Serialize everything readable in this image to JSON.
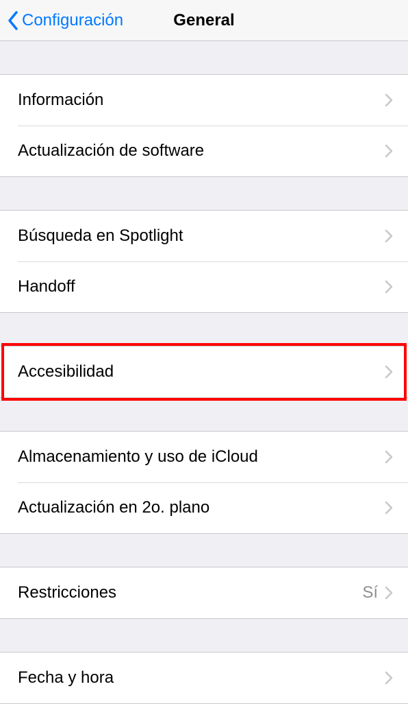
{
  "navbar": {
    "back_label": "Configuración",
    "title": "General"
  },
  "groups": [
    {
      "rows": [
        {
          "label": "Información"
        },
        {
          "label": "Actualización de software"
        }
      ]
    },
    {
      "rows": [
        {
          "label": "Búsqueda en Spotlight"
        },
        {
          "label": "Handoff"
        }
      ]
    },
    {
      "rows": [
        {
          "label": "Accesibilidad",
          "highlighted": true
        }
      ]
    },
    {
      "rows": [
        {
          "label": "Almacenamiento y uso de iCloud"
        },
        {
          "label": "Actualización en 2o. plano"
        }
      ]
    },
    {
      "rows": [
        {
          "label": "Restricciones",
          "value": "Sí"
        }
      ]
    },
    {
      "rows": [
        {
          "label": "Fecha y hora"
        }
      ]
    }
  ]
}
